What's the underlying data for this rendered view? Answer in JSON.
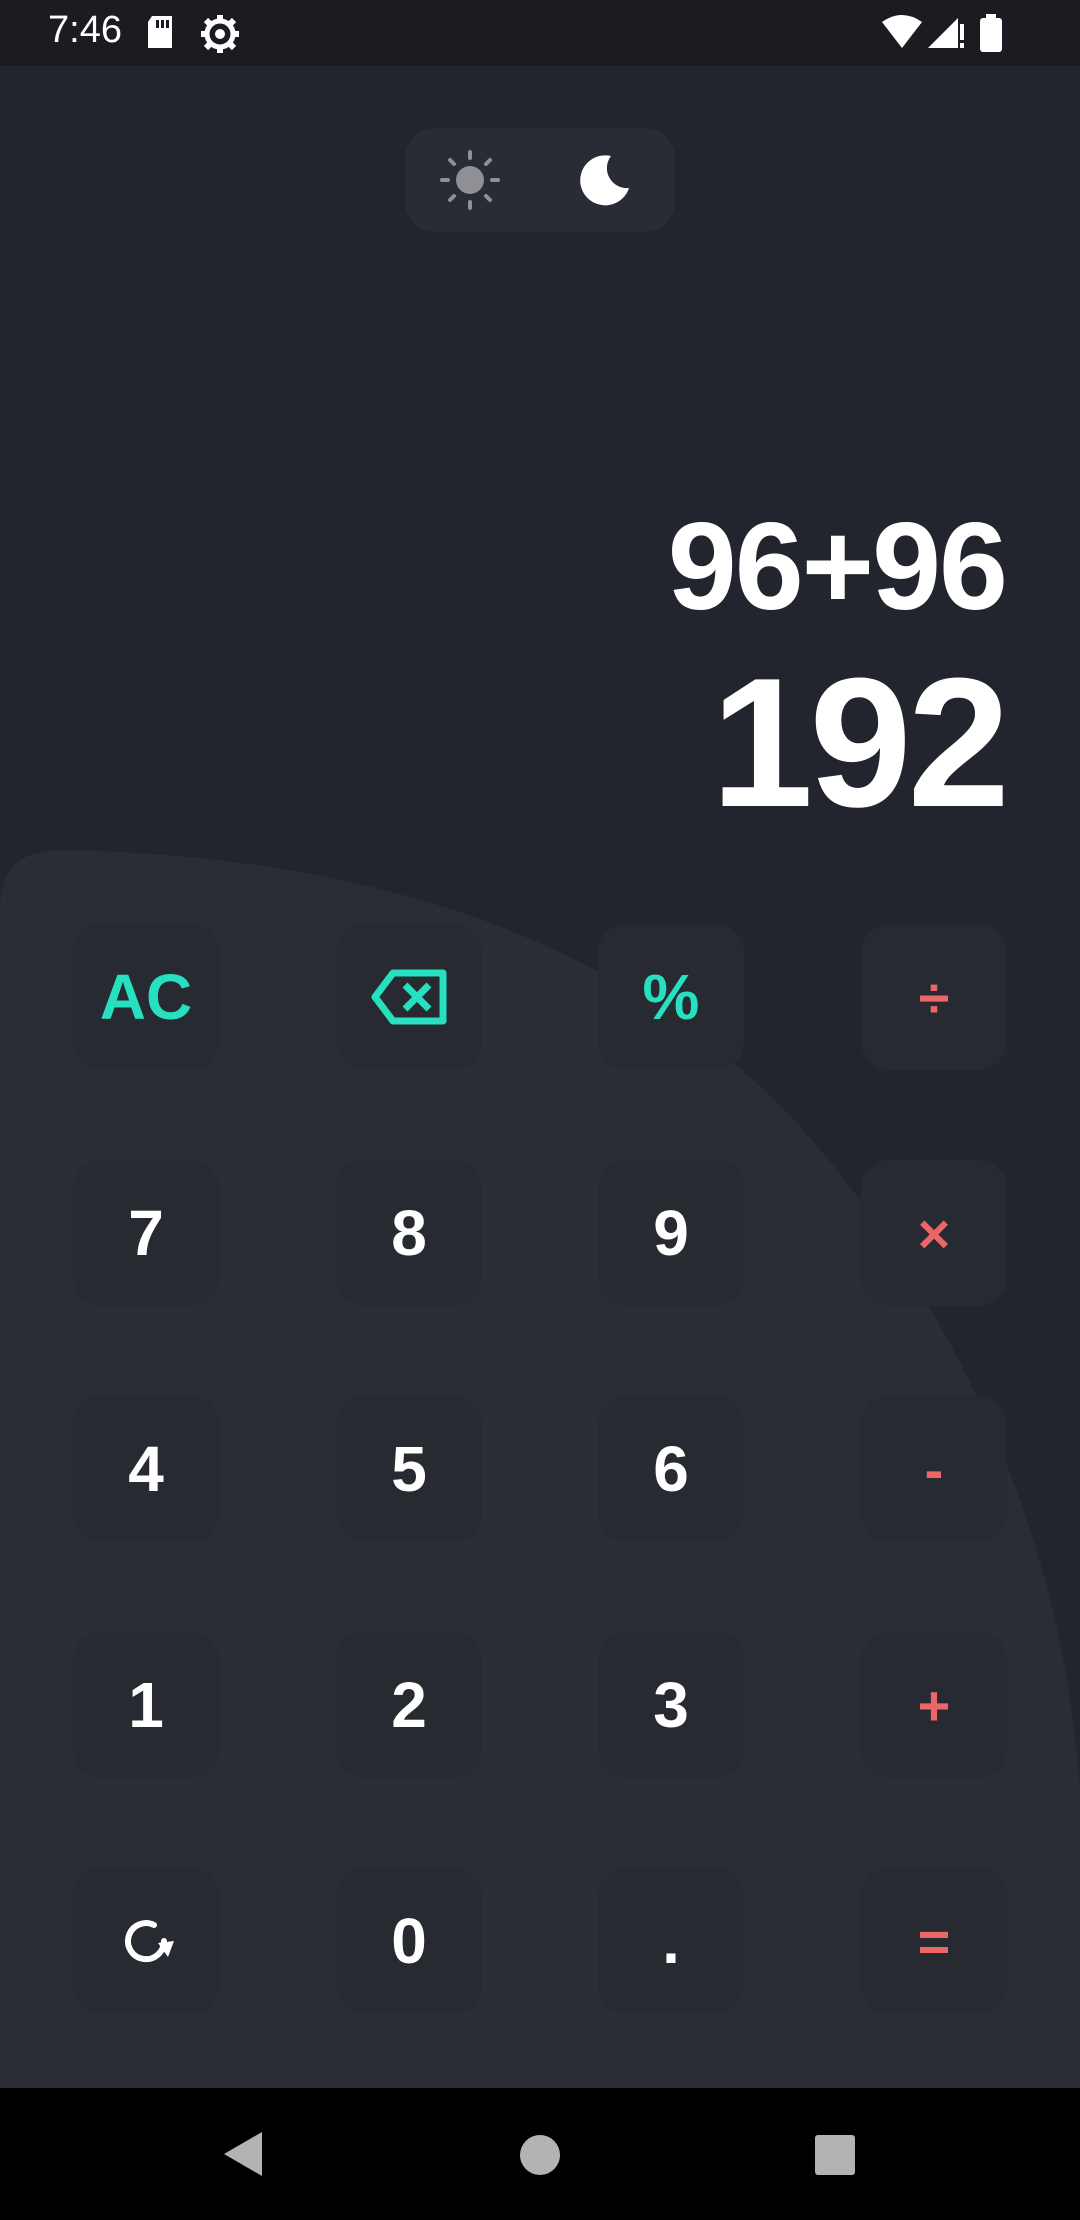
{
  "status_bar": {
    "time": "7:46",
    "icons": [
      "sd-card-icon",
      "settings-gear-icon",
      "wifi-icon",
      "cellular-signal-icon",
      "battery-icon"
    ]
  },
  "theme_toggle": {
    "options": [
      "light-mode-sun-icon",
      "dark-mode-moon-icon"
    ],
    "selected": "dark"
  },
  "display": {
    "expression": "96+96",
    "result": "192"
  },
  "keypad": {
    "row1": [
      "AC",
      "backspace",
      "%",
      "÷"
    ],
    "row2": [
      "7",
      "8",
      "9",
      "×"
    ],
    "row3": [
      "4",
      "5",
      "6",
      "-"
    ],
    "row4": [
      "1",
      "2",
      "3",
      "+"
    ],
    "row5": [
      "history",
      "0",
      ".",
      "="
    ]
  },
  "colors": {
    "background": "#22252d",
    "key_background": "#272a31",
    "function_accent": "#26e0c0",
    "operator_accent": "#eb6666",
    "digit": "#ffffff"
  },
  "nav_bar": {
    "icons": [
      "back-triangle-icon",
      "home-circle-icon",
      "recents-square-icon"
    ]
  }
}
